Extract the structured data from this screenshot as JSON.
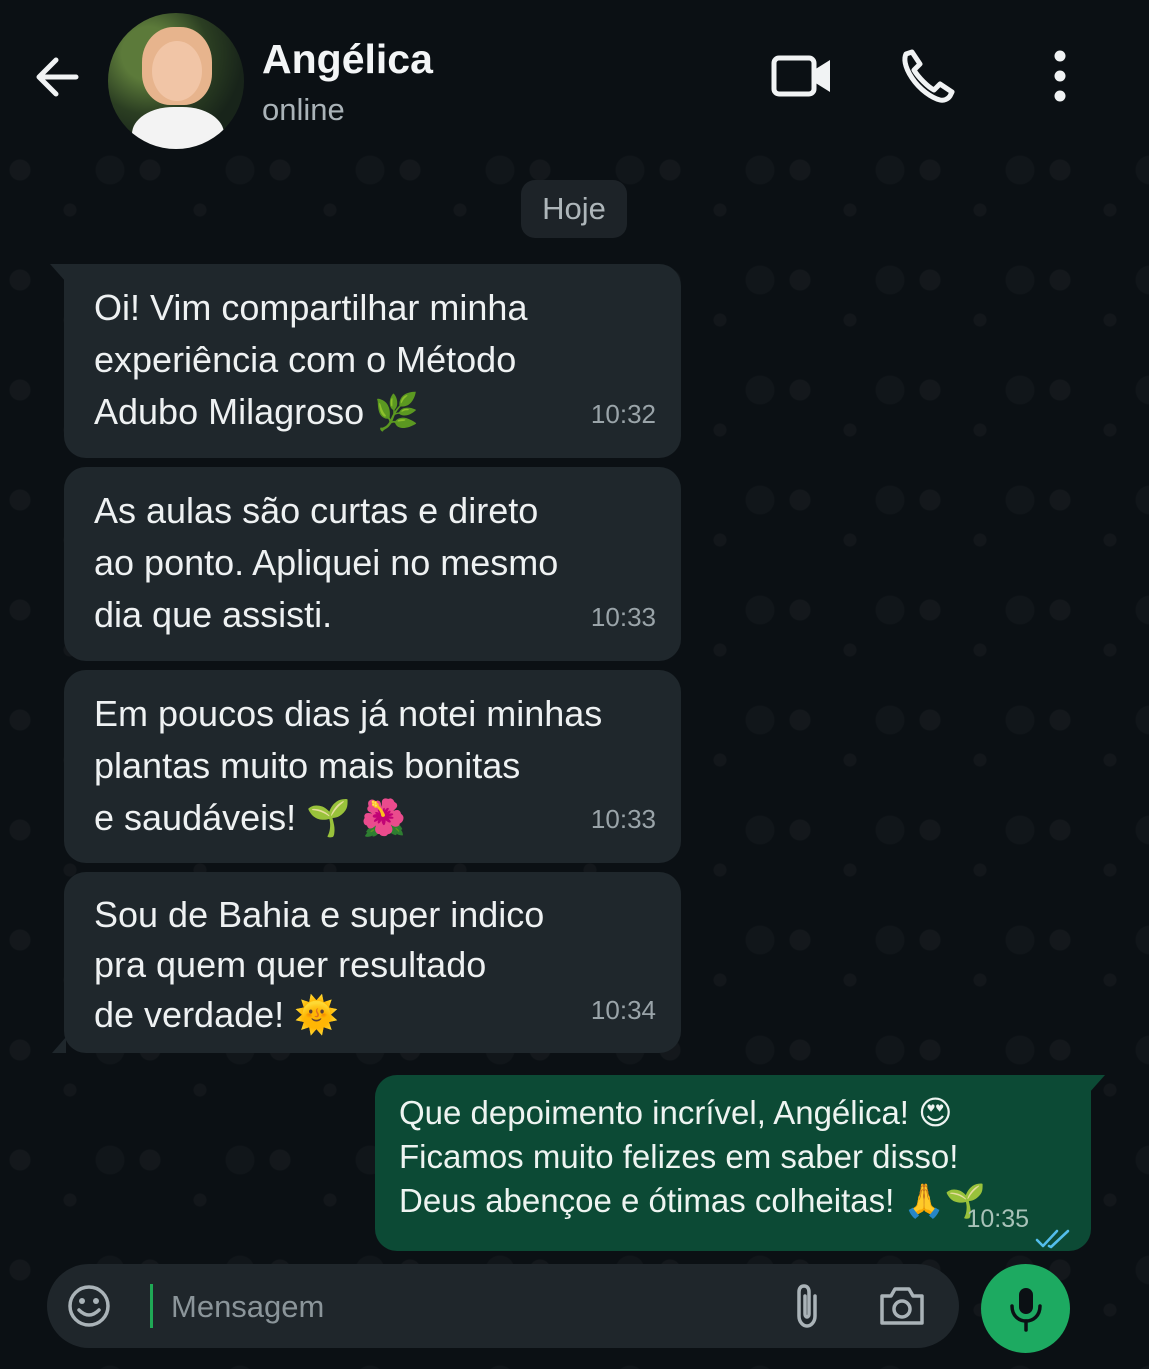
{
  "header": {
    "contact_name": "Angélica",
    "status": "online"
  },
  "date_chip": "Hoje",
  "messages_in": [
    {
      "text": "Oi! Vim compartilhar minha\nexperiência com o Método\nAdubo Milagroso 🌿",
      "time": "10:32"
    },
    {
      "text": "As aulas são curtas e direto\nao ponto. Apliquei no mesmo\ndia que assisti.",
      "time": "10:33"
    },
    {
      "text": "Em poucos dias já notei minhas\nplantas muito mais bonitas\ne saudáveis! 🌱 🌺",
      "time": "10:33"
    },
    {
      "text": "Sou de Bahia e super indico\npra quem quer resultado\nde verdade! 🌞",
      "time": "10:34"
    }
  ],
  "message_out": {
    "text": "Que depoimento incrível, Angélica! 😍\nFicamos muito felizes em saber disso!\nDeus abençoe e ótimas colheitas! 🙏🌱",
    "time": "10:35",
    "status_icon": "double-check-read-icon"
  },
  "composer": {
    "placeholder": "Mensagem",
    "value": ""
  },
  "colors": {
    "background": "#0b1014",
    "incoming_bubble": "#1f272c",
    "outgoing_bubble": "#0c4a35",
    "accent_green": "#1daa61",
    "read_ticks": "#53bdeb"
  }
}
